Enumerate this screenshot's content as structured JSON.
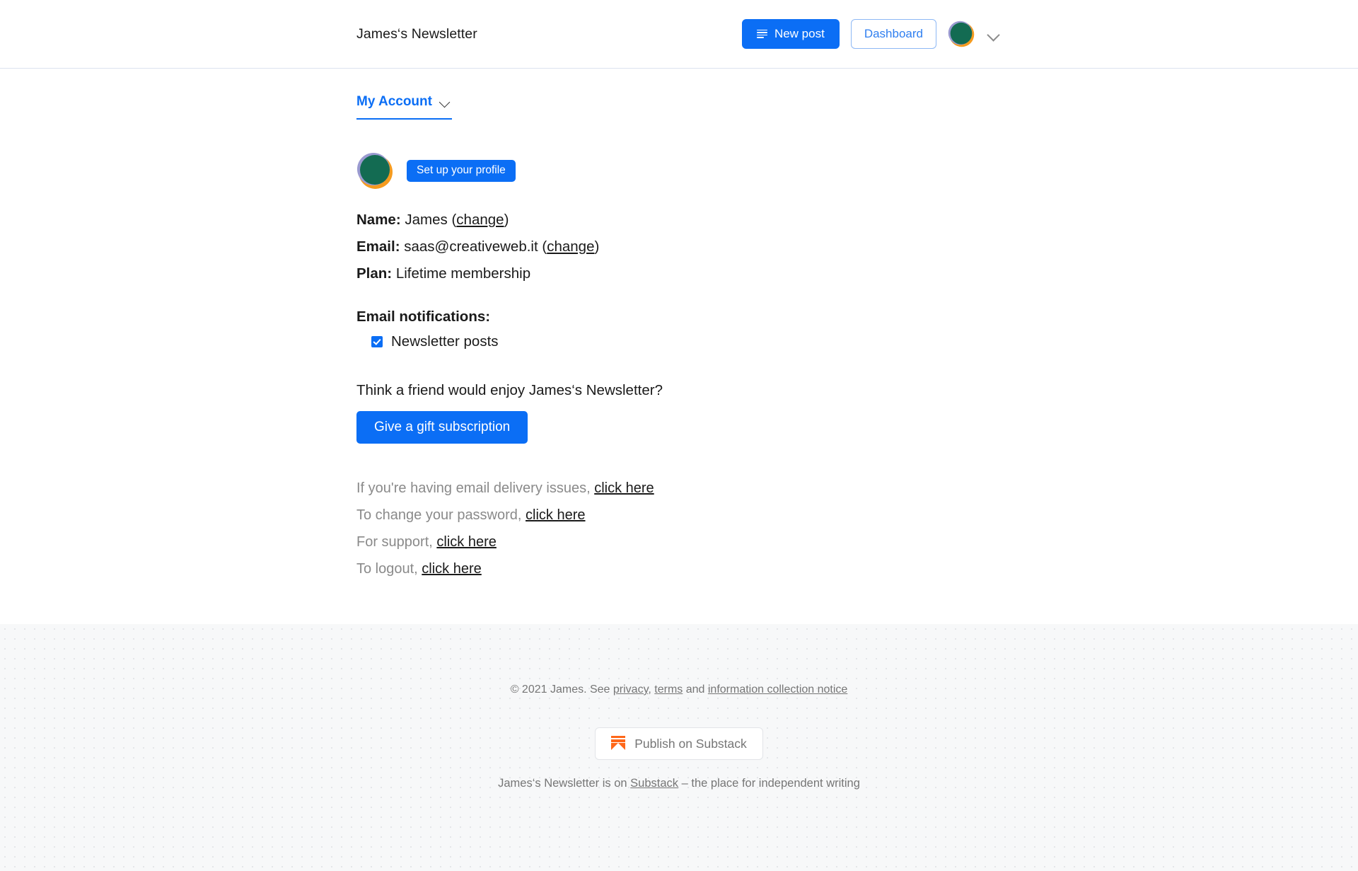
{
  "header": {
    "publication_title": "James‘s Newsletter",
    "new_post_label": "New post",
    "new_post_icon": "lines-icon",
    "dashboard_label": "Dashboard",
    "avatar_icon": "user-avatar",
    "account_menu_icon": "chevron-down-icon"
  },
  "tabs": {
    "active_label": "My Account",
    "chevron_icon": "chevron-down-icon"
  },
  "profile": {
    "avatar_icon": "user-avatar",
    "setup_button_label": "Set up your profile",
    "name_label": "Name:",
    "name_value": "James",
    "name_change_label": "change",
    "email_label": "Email:",
    "email_value": "saas@creativeweb.it",
    "email_change_label": "change",
    "plan_label": "Plan:",
    "plan_value": "Lifetime membership",
    "paren_open": "(",
    "paren_close": ")"
  },
  "notifications": {
    "title": "Email notifications:",
    "items": [
      {
        "label": "Newsletter posts",
        "checked": true,
        "icon": "checkbox-checked-icon"
      }
    ]
  },
  "gift": {
    "question": "Think a friend would enjoy James‘s Newsletter?",
    "button_label": "Give a gift subscription"
  },
  "help": {
    "lines": [
      {
        "text": "If you're having email delivery issues, ",
        "link": "click here"
      },
      {
        "text": "To change your password, ",
        "link": "click here"
      },
      {
        "text": "For support, ",
        "link": "click here"
      },
      {
        "text": "To logout, ",
        "link": "click here"
      }
    ]
  },
  "footer": {
    "copyright_prefix": "© 2021 James. See ",
    "privacy_label": "privacy",
    "comma": ", ",
    "terms_label": "terms",
    "and_label": " and ",
    "notice_label": "information collection notice",
    "publish_button_label": "Publish on Substack",
    "publish_icon": "substack-logo-icon",
    "tagline_prefix": "James‘s Newsletter is on ",
    "tagline_link": "Substack",
    "tagline_suffix": " – the place for independent writing"
  },
  "colors": {
    "accent_blue": "#0b6ef5",
    "substack_orange": "#ff6719",
    "avatar_green": "#136b52",
    "avatar_orange": "#f59b1f",
    "avatar_purple": "#9a9ad0",
    "muted_text": "#8a8a8a"
  }
}
